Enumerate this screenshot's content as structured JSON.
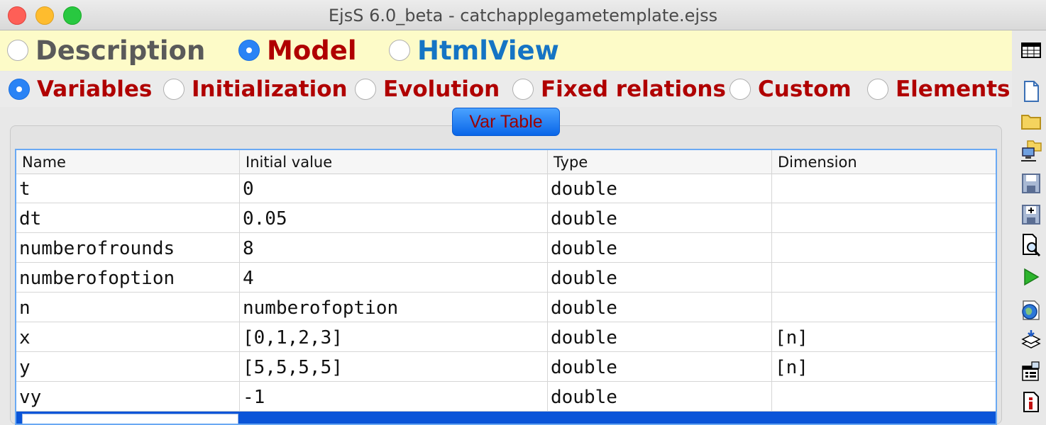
{
  "window": {
    "title": "EjsS 6.0_beta - catchapplegametemplate.ejss"
  },
  "main_tabs": [
    {
      "label": "Description",
      "selected": false,
      "color": "#5a5a5a"
    },
    {
      "label": "Model",
      "selected": true,
      "color": "#b00000"
    },
    {
      "label": "HtmlView",
      "selected": false,
      "color": "#1574c4"
    }
  ],
  "sub_tabs": [
    {
      "label": "Variables",
      "selected": true
    },
    {
      "label": "Initialization",
      "selected": false
    },
    {
      "label": "Evolution",
      "selected": false
    },
    {
      "label": "Fixed relations",
      "selected": false
    },
    {
      "label": "Custom",
      "selected": false
    },
    {
      "label": "Elements",
      "selected": false
    }
  ],
  "var_table": {
    "tab_label": "Var Table",
    "columns": [
      "Name",
      "Initial value",
      "Type",
      "Dimension"
    ],
    "rows": [
      [
        "t",
        "0",
        "double",
        ""
      ],
      [
        "dt",
        "0.05",
        "double",
        ""
      ],
      [
        "numberofrounds",
        "8",
        "double",
        ""
      ],
      [
        "numberofoption",
        "4",
        "double",
        ""
      ],
      [
        "n",
        "numberofoption",
        "double",
        ""
      ],
      [
        "x",
        "[0,1,2,3]",
        "double",
        "[n]"
      ],
      [
        "y",
        "[5,5,5,5]",
        "double",
        "[n]"
      ],
      [
        "vy",
        "-1",
        "double",
        ""
      ]
    ]
  },
  "toolbar_icons": [
    "table-icon",
    "new-file-icon",
    "open-folder-icon",
    "open-network-icon",
    "save-icon",
    "save-as-icon",
    "search-icon",
    "run-icon",
    "web-icon",
    "package-icon",
    "options-icon",
    "info-icon"
  ],
  "colors": {
    "accent": "#2a83f5",
    "sub_tab_text": "#b00000",
    "selection": "#0a55d8"
  }
}
